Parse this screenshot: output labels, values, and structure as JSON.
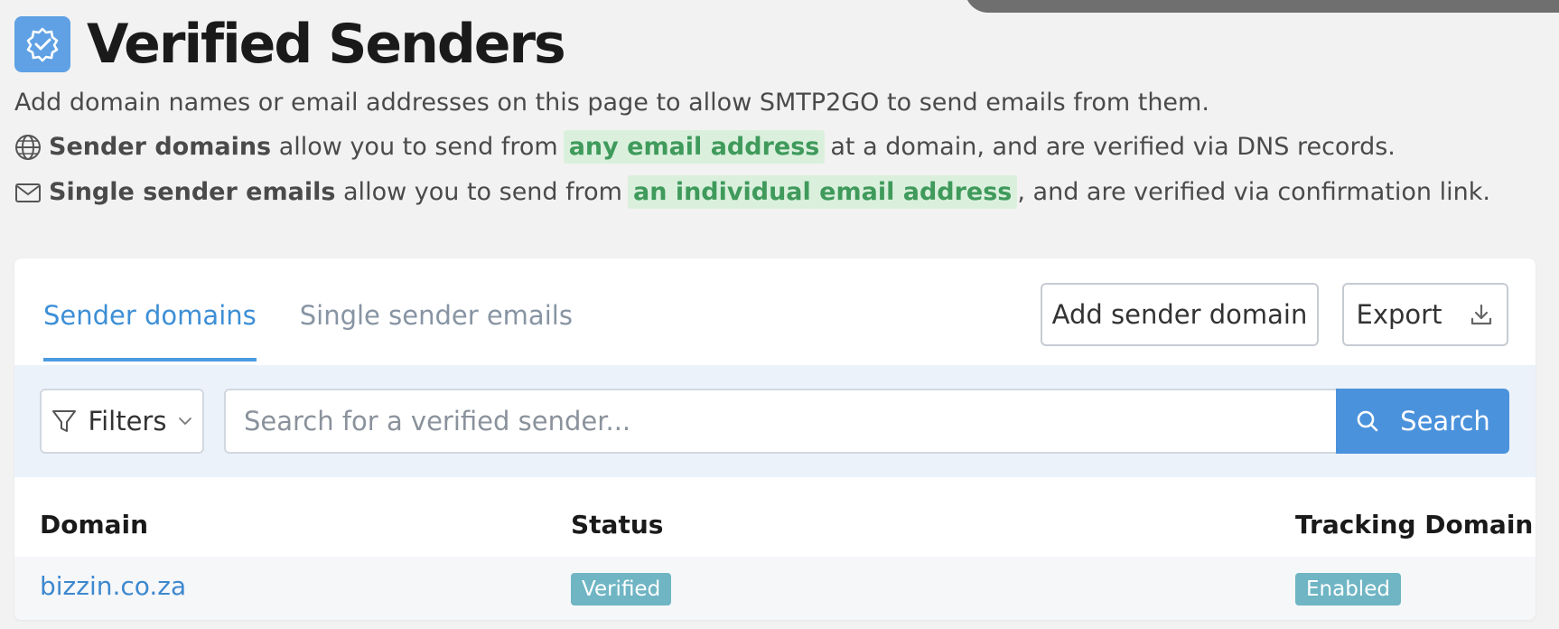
{
  "header": {
    "title": "Verified Senders",
    "title_icon": "verified-badge-icon",
    "accent_color": "#5fa1e4"
  },
  "description": {
    "intro": "Add domain names or email addresses on this page to allow SMTP2GO to send emails from them.",
    "domains_line": {
      "icon": "globe-icon",
      "bold": "Sender domains",
      "before": "allow you to send from",
      "highlight": "any email address",
      "after": "at a domain, and are verified via DNS records."
    },
    "emails_line": {
      "icon": "envelope-icon",
      "bold": "Single sender emails",
      "before": "allow you to send from",
      "highlight": "an individual email address",
      "after": ", and are verified via confirmation link."
    }
  },
  "tabs": [
    {
      "label": "Sender domains",
      "active": true
    },
    {
      "label": "Single sender emails",
      "active": false
    }
  ],
  "actions": {
    "add_label": "Add sender domain",
    "export_label": "Export",
    "export_icon": "download-icon"
  },
  "filter_bar": {
    "filters_label": "Filters",
    "filters_icon": "funnel-icon",
    "search_placeholder": "Search for a verified sender...",
    "search_value": "",
    "search_button_label": "Search",
    "search_icon": "search-icon"
  },
  "table": {
    "columns": [
      "Domain",
      "Status",
      "Tracking Domain"
    ],
    "rows": [
      {
        "domain": "bizzin.co.za",
        "status": "Verified",
        "tracking": "Enabled"
      }
    ]
  },
  "colors": {
    "primary_blue": "#4b92dc",
    "highlight_bg": "#daf0dd",
    "highlight_text": "#3f9a5b",
    "badge_bg": "#6fb5c4"
  }
}
